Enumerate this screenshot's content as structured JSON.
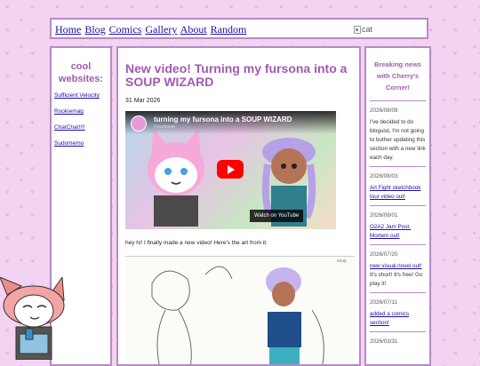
{
  "nav": {
    "links": [
      "Home",
      "Blog",
      "Comics",
      "Gallery",
      "About",
      "Random"
    ],
    "image_alt": "cat"
  },
  "left": {
    "title": "cool websites:",
    "links": [
      "Sufficient Velocity",
      "Rookiemag",
      "ChatChat!!!!",
      "Sudomemo"
    ]
  },
  "post": {
    "title": "New video! Turning my fursona into a SOUP WIZARD",
    "date": "31 Mar 2026",
    "video": {
      "title": "turning my fursona into a SOUP WIZARD",
      "channel": "Fourtowie",
      "watch_label": "Watch on",
      "platform": "YouTube"
    },
    "text": "hey hi! I finally made a new video! Here's the art from it:",
    "sketch_label": "soup"
  },
  "news": {
    "title": "Breaking news with Cherry's Corner!",
    "entries": [
      {
        "date": "2026/08/09",
        "text": "I've decided to do bloguist, I'm not going to bother updating this section with a new link each day.",
        "link": ""
      },
      {
        "date": "2026/08/03",
        "text": "",
        "link": "Art Fight sketchbook tour video out!"
      },
      {
        "date": "2026/08/01",
        "text": "",
        "link": "O2A2 Jam Post-Mortem out!"
      },
      {
        "date": "2026/07/20",
        "text": "It's short! It's free! Go play it!",
        "link": "new visual novel out!"
      },
      {
        "date": "2026/07/11",
        "text": "",
        "link": "added a comics section!"
      },
      {
        "date": "2026/03/31",
        "text": "",
        "link": ""
      }
    ]
  },
  "colors": {
    "accent": "#a15ab0",
    "border": "#b78ac4",
    "background": "#f2d3f2"
  }
}
